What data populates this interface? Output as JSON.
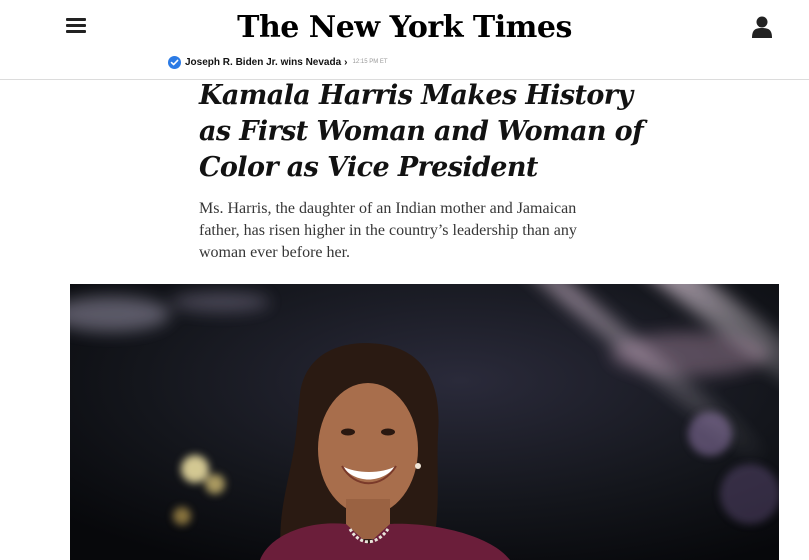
{
  "header": {
    "logo": "The New York Times",
    "menu_icon": "hamburger-menu-icon",
    "account_icon": "user-account-icon"
  },
  "breaking": {
    "icon": "check-circle-icon",
    "text": "Joseph R. Biden Jr. wins Nevada",
    "chevron": "›",
    "time": "12:15 PM ET"
  },
  "article": {
    "headline": "Kamala Harris Makes History as First Woman and Woman of Color as Vice President",
    "summary": "Ms. Harris, the daughter of an Indian mother and Jamaican father, has risen higher in the country’s leadership than any woman ever before her."
  },
  "colors": {
    "accent_check": "#2c7be5",
    "photo_background": "#0c0f14",
    "jacket": "#6b1e3a"
  }
}
